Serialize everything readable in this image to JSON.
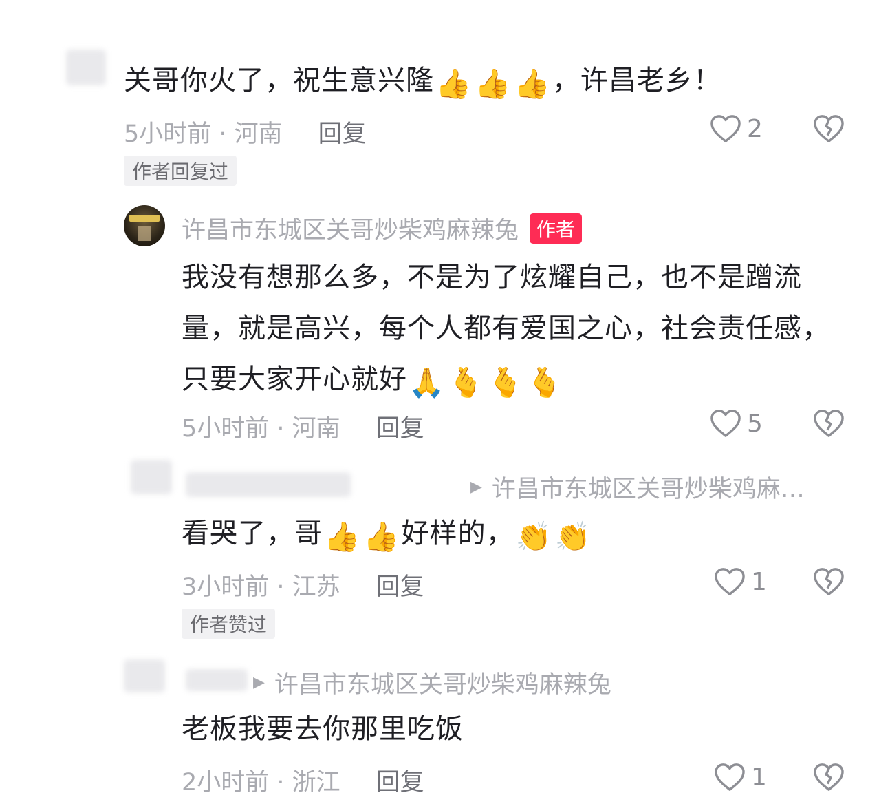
{
  "comments": [
    {
      "text": "关哥你火了，祝生意兴隆",
      "emojis": [
        "👍",
        "👍",
        "👍"
      ],
      "text_tail": "，许昌老乡！",
      "time_location": "5小时前 · 河南",
      "reply_label": "回复",
      "likes": "2",
      "badge": "作者回复过"
    },
    {
      "author": "许昌市东城区关哥炒柴鸡麻辣兔",
      "author_badge": "作者",
      "text": "我没有想那么多，不是为了炫耀自己，也不是蹭流量，就是高兴，每个人都有爱国之心，社会责任感，只要大家开心就好",
      "emojis": [
        "🙏",
        "🫰",
        "🫰",
        "🫰"
      ],
      "time_location": "5小时前 · 河南",
      "reply_label": "回复",
      "likes": "5"
    },
    {
      "reply_to": "许昌市东城区关哥炒柴鸡麻…",
      "text_a": "看哭了，哥",
      "emojis_a": [
        "👍",
        "👍"
      ],
      "text_b": "好样的，",
      "emojis_b": [
        "👏",
        "👏"
      ],
      "time_location": "3小时前 · 江苏",
      "reply_label": "回复",
      "likes": "1",
      "badge": "作者赞过"
    },
    {
      "reply_to": "许昌市东城区关哥炒柴鸡麻辣兔",
      "text": "老板我要去你那里吃饭",
      "time_location": "2小时前 · 浙江",
      "reply_label": "回复",
      "likes": "1"
    }
  ],
  "icons": {
    "like": "heart-outline-icon",
    "dislike": "broken-heart-icon",
    "reply_arrow": "triangle-right-icon"
  },
  "colors": {
    "author_badge": "#fe2c55",
    "meta_text": "#a9aab0"
  }
}
